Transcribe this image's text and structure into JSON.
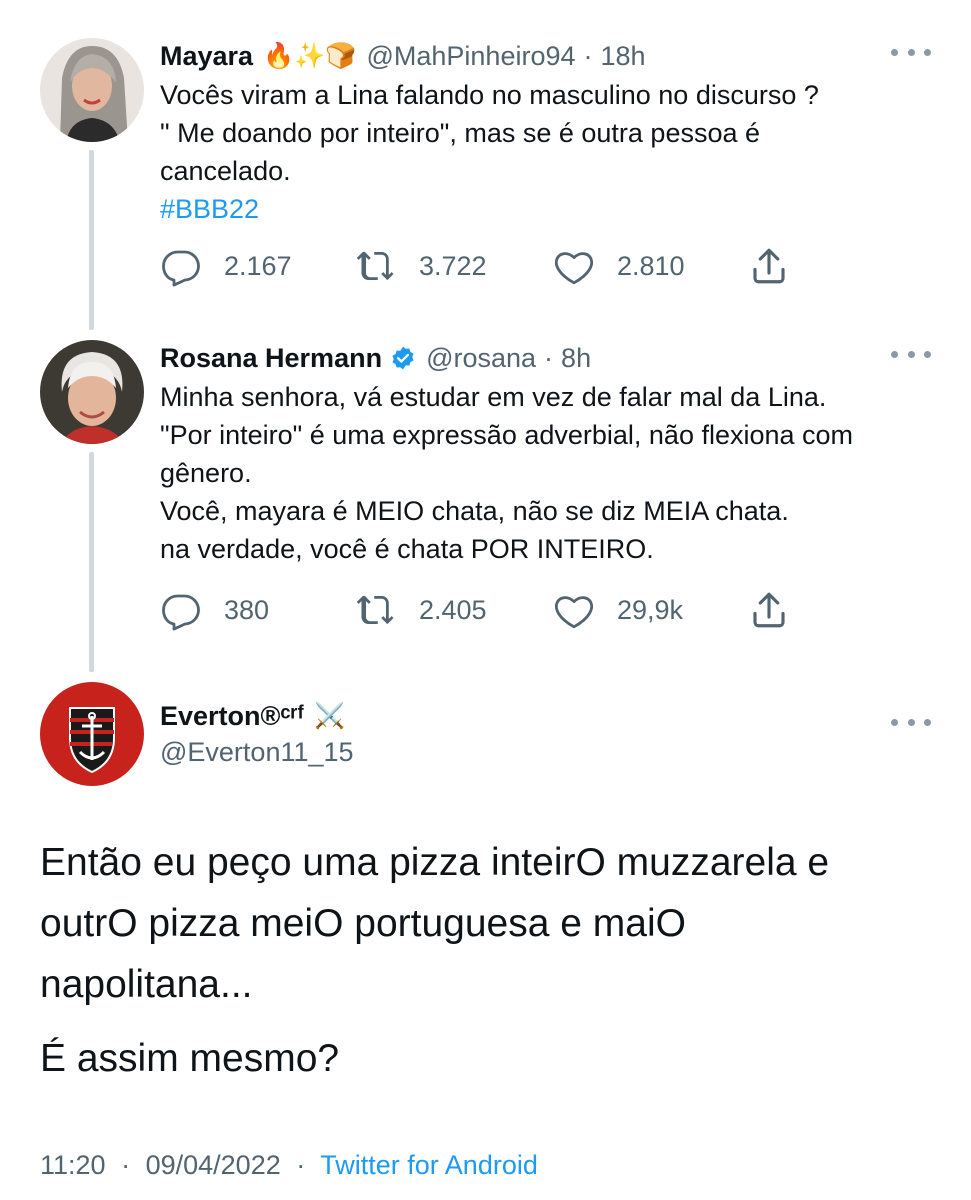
{
  "tweets": [
    {
      "name": "Mayara",
      "emoji": "🔥✨🍞",
      "handle": "@MahPinheiro94",
      "separator": "·",
      "time": "18h",
      "lines": [
        "Vocês viram a Lina falando no masculino no discurso ?",
        "\" Me doando por inteiro\", mas se é outra pessoa é",
        "cancelado."
      ],
      "hashtag": "#BBB22",
      "replies": "2.167",
      "retweets": "3.722",
      "likes": "2.810"
    },
    {
      "name": "Rosana Hermann",
      "handle": "@rosana",
      "separator": "·",
      "time": "8h",
      "lines": [
        "Minha senhora, vá estudar em vez de falar mal da Lina.",
        "\"Por inteiro\" é uma expressão adverbial, não flexiona com",
        "gênero.",
        "Você, mayara é MEIO chata, não se diz MEIA chata.",
        "na verdade, você é chata POR INTEIRO."
      ],
      "replies": "380",
      "retweets": "2.405",
      "likes": "29,9k"
    }
  ],
  "main_tweet": {
    "name": "Everton®ᶜʳᶠ",
    "emoji": "⚔️",
    "handle": "@Everton11_15",
    "lines": [
      "Então eu peço uma pizza inteirO muzzarela e",
      "outrO pizza meiO portuguesa e maiO",
      "napolitana..."
    ],
    "line2": "É assim mesmo?",
    "time": "11:20",
    "separator": "·",
    "date": "09/04/2022",
    "separator2": "·",
    "source": "Twitter for Android"
  },
  "colors": {
    "link": "#1d9bf0",
    "secondary_text": "#536471",
    "verified": "#1d9bf0",
    "thread_line": "#cfd9de"
  },
  "icons": [
    "reply-icon",
    "retweet-icon",
    "like-icon",
    "share-icon",
    "more-icon",
    "verified-icon"
  ]
}
